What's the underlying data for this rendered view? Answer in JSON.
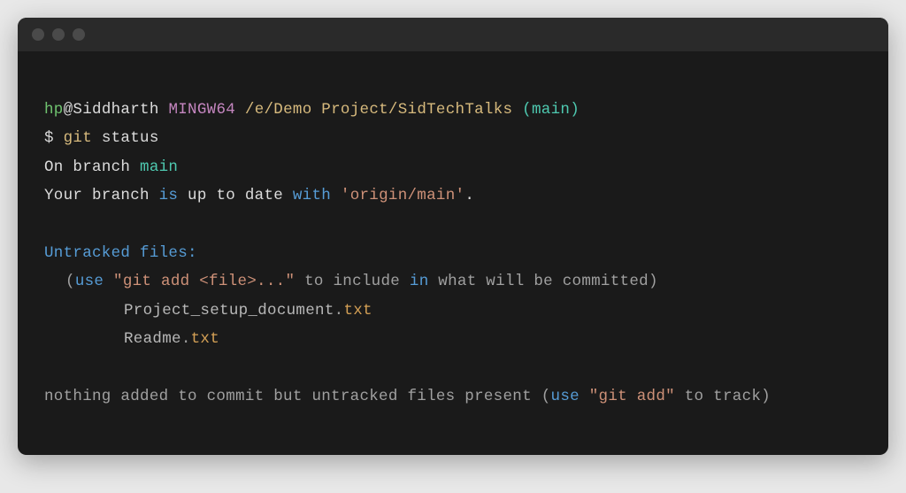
{
  "prompt": {
    "user": "hp",
    "at": "@",
    "host": "Siddharth",
    "env": "MINGW64",
    "path": "/e/Demo Project/SidTechTalks",
    "branch_open": "(",
    "branch": "main",
    "branch_close": ")"
  },
  "command": {
    "symbol": "$ ",
    "cmd": "git",
    "arg": " status"
  },
  "status": {
    "on": "On",
    "branch_word": " branch ",
    "branch_name": "main",
    "uptodate_1": "Your branch ",
    "uptodate_is": "is",
    "uptodate_2": " up to date ",
    "uptodate_with": "with",
    "uptodate_3": " ",
    "origin": "'origin/main'",
    "uptodate_dot": "."
  },
  "untracked": {
    "header": "Untracked files:",
    "hint_open": "(",
    "hint_use": "use",
    "hint_sp1": " ",
    "hint_cmd": "\"git add <file>...\"",
    "hint_sp2": " to include ",
    "hint_in": "in",
    "hint_sp3": " what will be committed",
    "hint_close": ")",
    "file1_name": "Project_setup_document",
    "file1_dot": ".",
    "file1_ext": "txt",
    "file2_name": "Readme",
    "file2_dot": ".",
    "file2_ext": "txt"
  },
  "footer": {
    "part1": "nothing added to commit but untracked files present ",
    "paren_open": "(",
    "use": "use",
    "sp": " ",
    "gitadd": "\"git add\"",
    "part2": " to track",
    "paren_close": ")"
  }
}
